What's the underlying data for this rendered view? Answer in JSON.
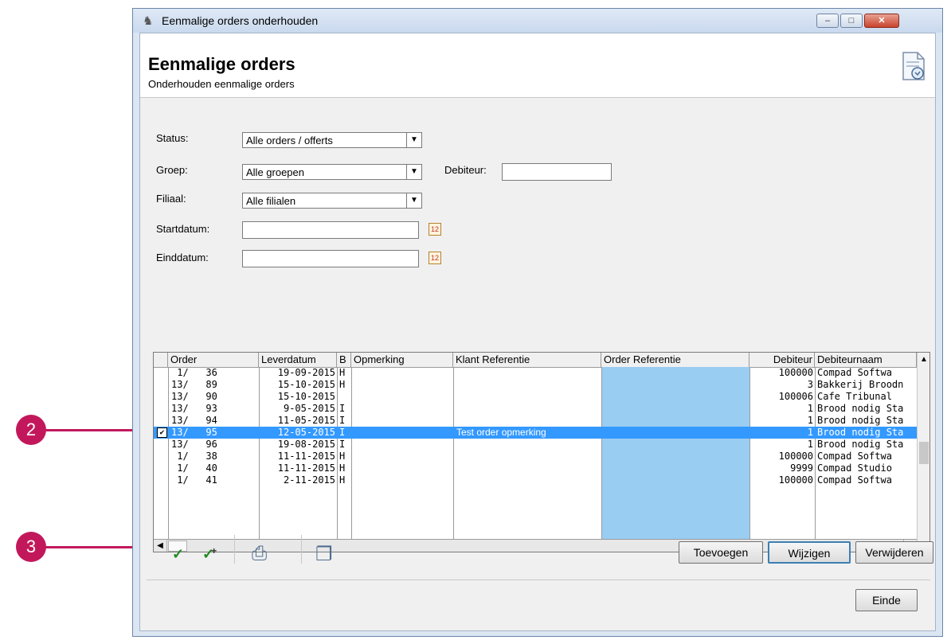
{
  "window": {
    "title": "Eenmalige orders onderhouden",
    "min_glyph": "–",
    "max_glyph": "□",
    "close_glyph": "✕"
  },
  "header": {
    "title": "Eenmalige orders",
    "subtitle": "Onderhouden eenmalige orders"
  },
  "filters": {
    "status_label": "Status:",
    "status_value": "Alle orders / offerts",
    "groep_label": "Groep:",
    "groep_value": "Alle groepen",
    "debiteur_label": "Debiteur:",
    "debiteur_value": "",
    "filiaal_label": "Filiaal:",
    "filiaal_value": "Alle filialen",
    "startdatum_label": "Startdatum:",
    "startdatum_value": "",
    "einddatum_label": "Einddatum:",
    "einddatum_value": ""
  },
  "grid": {
    "columns": [
      "Order",
      "Leverdatum",
      "B",
      "Opmerking",
      "Klant Referentie",
      "Order Referentie",
      "Debiteur",
      "Debiteurnaam"
    ],
    "rows": [
      {
        "order": " 1/   36",
        "date": "19-09-2015",
        "b": "H",
        "opm": "",
        "klant": "",
        "orderref": "",
        "deb": "100000",
        "name": "Compad Softwa"
      },
      {
        "order": "13/   89",
        "date": "15-10-2015",
        "b": "H",
        "opm": "",
        "klant": "",
        "orderref": "",
        "deb": "3",
        "name": "Bakkerij Broodn"
      },
      {
        "order": "13/   90",
        "date": "15-10-2015",
        "b": "",
        "opm": "",
        "klant": "",
        "orderref": "",
        "deb": "100006",
        "name": "Cafe Tribunal"
      },
      {
        "order": "13/   93",
        "date": " 9-05-2015",
        "b": "I",
        "opm": "",
        "klant": "",
        "orderref": "",
        "deb": "1",
        "name": "Brood nodig Sta"
      },
      {
        "order": "13/   94",
        "date": "11-05-2015",
        "b": "I",
        "opm": "",
        "klant": "",
        "orderref": "",
        "deb": "1",
        "name": "Brood nodig Sta"
      },
      {
        "order": "13/   95",
        "date": "12-05-2015",
        "b": "I",
        "opm": "",
        "klant": "Test order opmerking",
        "orderref": "",
        "deb": "1",
        "name": "Brood nodig Sta",
        "selected": true,
        "check": "✔"
      },
      {
        "order": "13/   96",
        "date": "19-08-2015",
        "b": "I",
        "opm": "",
        "klant": "",
        "orderref": "",
        "deb": "1",
        "name": "Brood nodig Sta"
      },
      {
        "order": " 1/   38",
        "date": "11-11-2015",
        "b": "H",
        "opm": "",
        "klant": "",
        "orderref": "",
        "deb": "100000",
        "name": "Compad Softwa"
      },
      {
        "order": " 1/   40",
        "date": "11-11-2015",
        "b": "H",
        "opm": "",
        "klant": "",
        "orderref": "",
        "deb": "9999",
        "name": "Compad Studio"
      },
      {
        "order": " 1/   41",
        "date": " 2-11-2015",
        "b": "H",
        "opm": "",
        "klant": "",
        "orderref": "",
        "deb": "100000",
        "name": "Compad Softwa"
      }
    ]
  },
  "toolbar": {
    "check_glyph": "✓",
    "check_plus_glyph": "✓",
    "print_glyph": "⎙",
    "copy_glyph": "❐"
  },
  "buttons": {
    "toevoegen": "Toevoegen",
    "wijzigen": "Wijzigen",
    "verwijderen": "Verwijderen",
    "einde": "Einde"
  },
  "callouts": {
    "two": "2",
    "three": "3"
  },
  "colors": {
    "selection": "#3399ff",
    "order_ref_column": "#99cdf2",
    "callout": "#c2185b"
  }
}
